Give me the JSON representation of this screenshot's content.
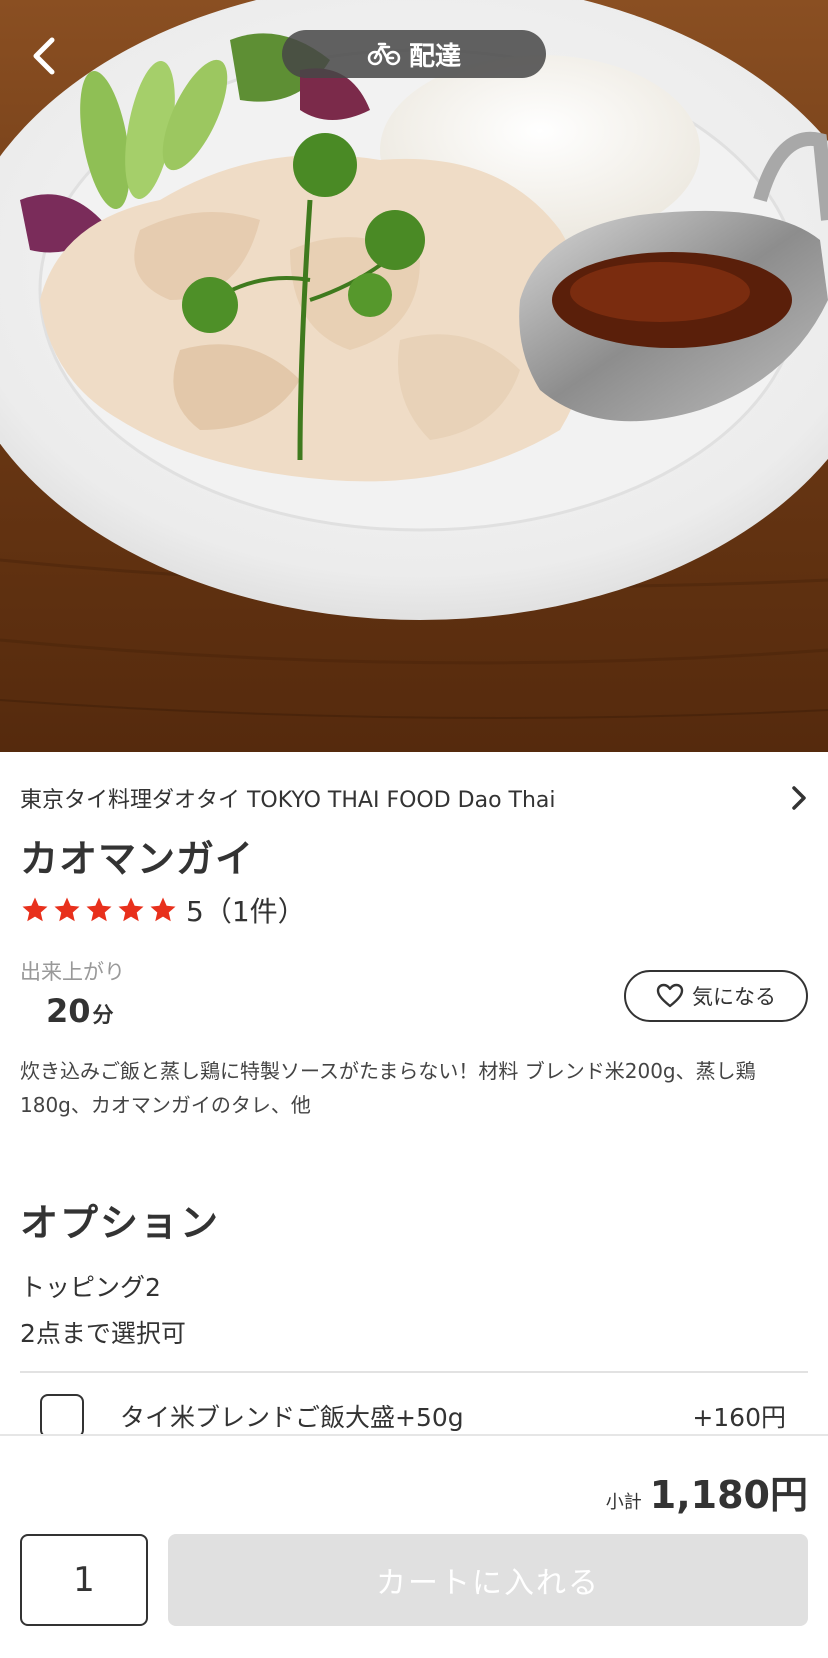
{
  "header": {
    "mode_label": "配達",
    "mode_icon": "bicycle-icon",
    "back_icon": "chevron-left-icon"
  },
  "hero": {
    "image_icon": "food-photo"
  },
  "item": {
    "shop_name": "東京タイ料理ダオタイ TOKYO THAI FOOD Dao Thai",
    "title": "カオマンガイ",
    "rating_text": "5（1件）",
    "stars": 5,
    "star_color": "#e8301c",
    "prep_label": "出来上がり",
    "prep_value": "20",
    "prep_unit": "分",
    "favorite_label": "気になる",
    "description": "炊き込みご飯と蒸し鶏に特製ソースがたまらない！材料 ブレンド米200g、蒸し鶏180g、カオマンガイのタレ、他"
  },
  "options": {
    "heading": "オプション",
    "group_name": "トッピング2",
    "group_limit": "2点まで選択可",
    "items": [
      {
        "label": "タイ米ブレンドご飯大盛+50g",
        "price": "+160円",
        "checked": false
      }
    ]
  },
  "footer": {
    "subtotal_label": "小計",
    "subtotal_value": "1,180円",
    "quantity": "1",
    "cart_button_label": "カートに入れる",
    "cart_button_color": "#e0e0e0"
  }
}
